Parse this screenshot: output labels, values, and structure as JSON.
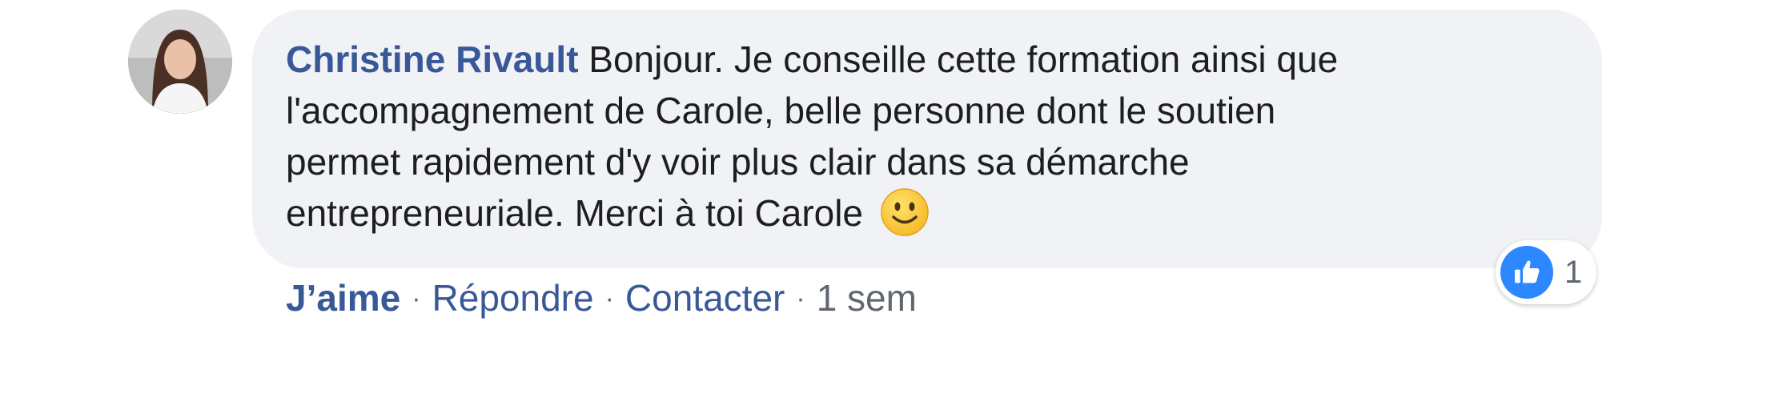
{
  "comment": {
    "author": "Christine Rivault",
    "text_lines": [
      "Bonjour. Je conseille cette formation ainsi que",
      "l'accompagnement de Carole, belle personne dont le soutien",
      "permet rapidement d'y voir plus clair dans sa démarche",
      "entrepreneuriale. Merci à toi Carole"
    ],
    "emoji": "slightly-smiling-face-emoji"
  },
  "reactions": {
    "icon": "thumbs-up-icon",
    "count": "1",
    "color": "#2d88ff"
  },
  "actions": {
    "like_label": "J’aime",
    "reply_label": "Répondre",
    "contact_label": "Contacter",
    "separator": "·",
    "timestamp": "1 sem"
  },
  "colors": {
    "link": "#385898",
    "bubble_bg": "#f1f2f5",
    "meta_text": "#606770"
  }
}
